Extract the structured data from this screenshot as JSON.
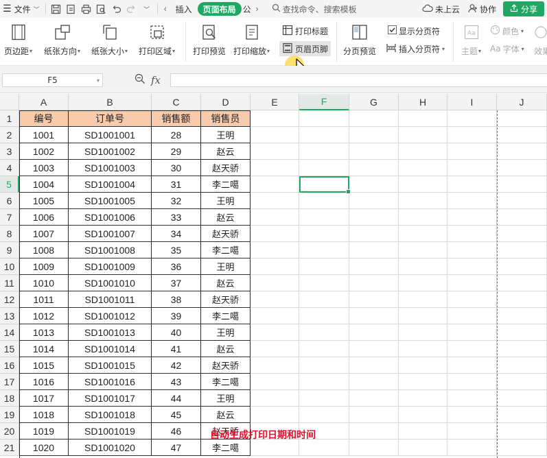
{
  "topbar": {
    "menu_label": "文件",
    "tabs": [
      {
        "label": "插入",
        "active": false
      },
      {
        "label": "页面布局",
        "active": true
      },
      {
        "label": "公",
        "active": false
      }
    ],
    "search_placeholder": "查找命令、搜索模板",
    "cloud_label": "未上云",
    "collab_label": "协作",
    "share_label": "分享"
  },
  "ribbon": {
    "margins": "页边距",
    "orientation": "纸张方向",
    "size": "纸张大小",
    "print_area": "打印区域",
    "print_preview": "打印预览",
    "print_scale": "打印缩放",
    "print_titles": "打印标题",
    "header_footer": "页眉页脚",
    "page_break_preview": "分页预览",
    "show_page_breaks": "显示分页符",
    "insert_page_break": "插入分页符",
    "theme": "主题",
    "colors": "颜色",
    "fonts": "字体",
    "effects": "效果",
    "font_glyph": "Aa"
  },
  "formula_bar": {
    "name_box": "F5",
    "fx_label": "fx",
    "formula_value": ""
  },
  "grid": {
    "columns": [
      "A",
      "B",
      "C",
      "D",
      "E",
      "F",
      "G",
      "H",
      "I",
      "J"
    ],
    "selected_column": "F",
    "selected_row": "5",
    "header_row": [
      "编号",
      "订单号",
      "销售额",
      "销售员"
    ],
    "rows": [
      [
        "1001",
        "SD1001001",
        "28",
        "王明"
      ],
      [
        "1002",
        "SD1001002",
        "29",
        "赵云"
      ],
      [
        "1003",
        "SD1001003",
        "30",
        "赵天骄"
      ],
      [
        "1004",
        "SD1001004",
        "31",
        "李二噶"
      ],
      [
        "1005",
        "SD1001005",
        "32",
        "王明"
      ],
      [
        "1006",
        "SD1001006",
        "33",
        "赵云"
      ],
      [
        "1007",
        "SD1001007",
        "34",
        "赵天骄"
      ],
      [
        "1008",
        "SD1001008",
        "35",
        "李二噶"
      ],
      [
        "1009",
        "SD1001009",
        "36",
        "王明"
      ],
      [
        "1010",
        "SD1001010",
        "37",
        "赵云"
      ],
      [
        "1011",
        "SD1001011",
        "38",
        "赵天骄"
      ],
      [
        "1012",
        "SD1001012",
        "39",
        "李二噶"
      ],
      [
        "1013",
        "SD1001013",
        "40",
        "王明"
      ],
      [
        "1014",
        "SD1001014",
        "41",
        "赵云"
      ],
      [
        "1015",
        "SD1001015",
        "42",
        "赵天骄"
      ],
      [
        "1016",
        "SD1001016",
        "43",
        "李二噶"
      ],
      [
        "1017",
        "SD1001017",
        "44",
        "王明"
      ],
      [
        "1018",
        "SD1001018",
        "45",
        "赵云"
      ],
      [
        "1019",
        "SD1001019",
        "46",
        "赵天骄"
      ],
      [
        "1020",
        "SD1001020",
        "47",
        "李二噶"
      ]
    ],
    "row_numbers": [
      "1",
      "2",
      "3",
      "4",
      "5",
      "6",
      "7",
      "8",
      "9",
      "10",
      "11",
      "12",
      "13",
      "14",
      "15",
      "16",
      "17",
      "18",
      "19",
      "20",
      "21"
    ]
  },
  "overlay_caption": "自动生成打印日期和时间",
  "colors": {
    "accent": "#1ea864",
    "table_header_fill": "#f8cbad",
    "caption": "#e8102a"
  }
}
